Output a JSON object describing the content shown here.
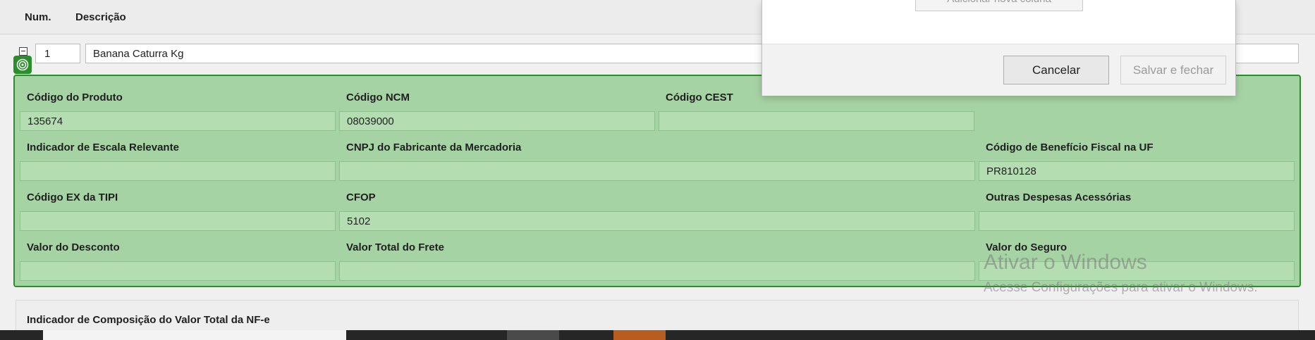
{
  "table_header": {
    "num_label": "Num.",
    "description_label": "Descrição"
  },
  "item": {
    "num": "1",
    "description": "Banana Caturra Kg"
  },
  "details": {
    "codigo_produto": {
      "label": "Código do Produto",
      "value": "135674"
    },
    "codigo_ncm": {
      "label": "Código NCM",
      "value": "08039000"
    },
    "codigo_cest": {
      "label": "Código CEST",
      "value": ""
    },
    "indicador_escala": {
      "label": "Indicador de Escala Relevante",
      "value": ""
    },
    "cnpj_fabricante": {
      "label": "CNPJ do Fabricante da Mercadoria",
      "value": ""
    },
    "codigo_beneficio": {
      "label": "Código de Benefício Fiscal na UF",
      "value": "PR810128"
    },
    "codigo_ex_tipi": {
      "label": "Código EX da TIPI",
      "value": ""
    },
    "cfop": {
      "label": "CFOP",
      "value": "5102"
    },
    "outras_despesas": {
      "label": "Outras Despesas Acessórias",
      "value": ""
    },
    "valor_desconto": {
      "label": "Valor do Desconto",
      "value": ""
    },
    "valor_frete": {
      "label": "Valor Total do Frete",
      "value": ""
    },
    "valor_seguro": {
      "label": "Valor do Seguro",
      "value": ""
    }
  },
  "lower_section": {
    "label": "Indicador de Composição do Valor Total da NF-e"
  },
  "dialog": {
    "add_column_label": "Adicionar nova coluna",
    "cancel_label": "Cancelar",
    "save_close_label": "Salvar e fechar"
  },
  "watermark": {
    "title": "Ativar o Windows",
    "subtitle": "Acesse Configurações para ativar o Windows."
  },
  "colors": {
    "panel_green": "#a6d3a4",
    "panel_border": "#2a8f2a",
    "input_green": "#b4deb2"
  },
  "icons": {
    "collapse": "minus-box-icon",
    "target": "target-icon"
  }
}
